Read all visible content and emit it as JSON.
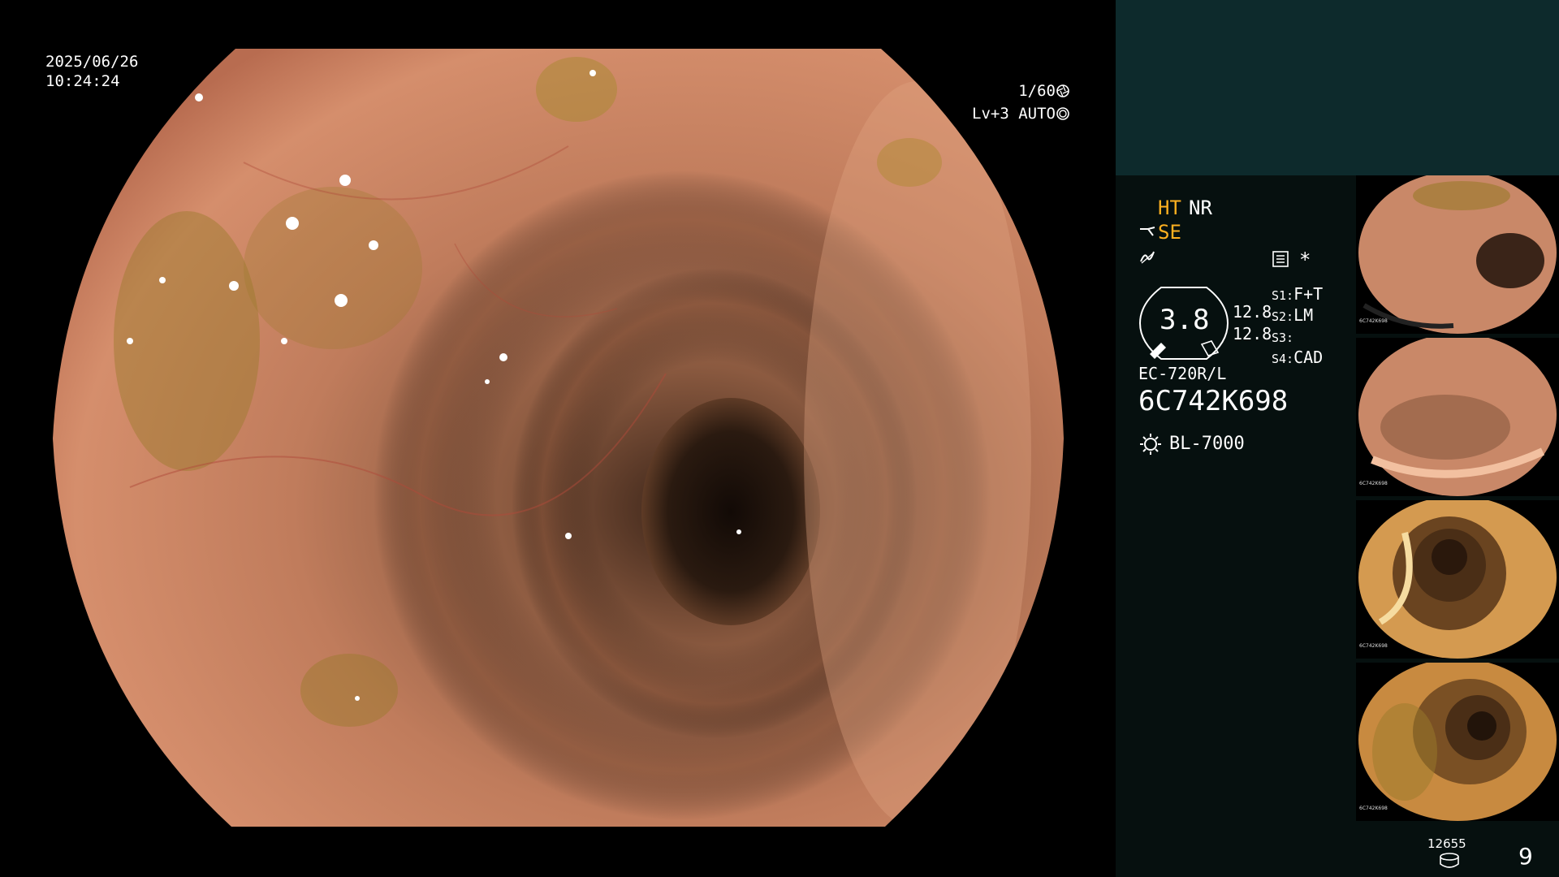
{
  "overlay": {
    "date": "2025/06/26",
    "time": "10:24:24",
    "shutter": "1/60",
    "level": "Lv+3 AUTO"
  },
  "panel": {
    "ht": "HT",
    "nr": "NR",
    "se": "SE",
    "brightness_value": "3.8",
    "readouts": [
      "12.8",
      "12.8"
    ],
    "switches": [
      {
        "key": "S1:",
        "value": "F+T"
      },
      {
        "key": "S2:",
        "value": "LM"
      },
      {
        "key": "S3:",
        "value": ""
      },
      {
        "key": "S4:",
        "value": "CAD"
      }
    ],
    "star": "*",
    "scope_model": "EC-720R/L",
    "scope_serial": "6C742K698",
    "light_source": "BL-7000",
    "storage_count": "12655",
    "image_count": "9"
  },
  "thumbnails": [
    {
      "label": "6C742K698"
    },
    {
      "label": "6C742K698"
    },
    {
      "label": "6C742K698"
    },
    {
      "label": "6C742K698"
    }
  ],
  "colors": {
    "panel_bg": "#06100f",
    "panel_top": "#0d2a2c",
    "accent_orange": "#ffb020"
  },
  "icons": [
    "aperture-icon",
    "metering-icon",
    "scope-icon",
    "waveform-icon",
    "memory-icon",
    "brightness-gauge-icon",
    "light-source-icon",
    "storage-icon"
  ]
}
